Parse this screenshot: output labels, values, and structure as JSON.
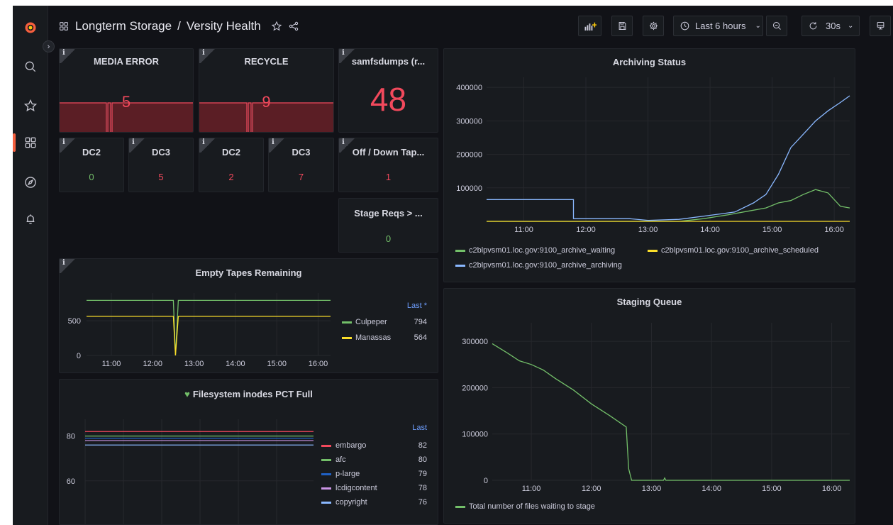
{
  "breadcrumb": {
    "folder": "Longterm Storage",
    "separator": "/",
    "dashboard": "Versity Health"
  },
  "toolbar": {
    "time_range": "Last 6 hours",
    "refresh_interval": "30s"
  },
  "colors": {
    "accent": "#f55f3e",
    "green": "#73bf69",
    "yellow": "#fade2a",
    "red": "#f2495c",
    "blue": "#8ab8ff",
    "dark_blue": "#1f60c4",
    "purple": "#ca95e5",
    "orange": "#ff9830"
  },
  "panels": {
    "media_error": {
      "title": "MEDIA ERROR",
      "value": "5"
    },
    "recycle": {
      "title": "RECYCLE",
      "value": "9"
    },
    "samfsdumps": {
      "title": "samfsdumps (r...",
      "value": "48"
    },
    "dc2_a": {
      "title": "DC2",
      "value": "0"
    },
    "dc3_a": {
      "title": "DC3",
      "value": "5"
    },
    "dc2_b": {
      "title": "DC2",
      "value": "2"
    },
    "dc3_b": {
      "title": "DC3",
      "value": "7"
    },
    "off_down": {
      "title": "Off / Down Tap...",
      "value": "1"
    },
    "stage_reqs": {
      "title": "Stage Reqs > ...",
      "value": "0"
    }
  },
  "chart_data": [
    {
      "type": "line",
      "title": "Archiving Status",
      "x_ticks": [
        "11:00",
        "12:00",
        "13:00",
        "14:00",
        "15:00",
        "16:00"
      ],
      "y_ticks": [
        "100000",
        "200000",
        "300000",
        "400000"
      ],
      "ylim": [
        0,
        430000
      ],
      "series": [
        {
          "name": "c2blpvsm01.loc.gov:9100_archive_waiting",
          "color": "#73bf69",
          "points": [
            [
              10.4,
              0
            ],
            [
              11.0,
              0
            ],
            [
              12.0,
              0
            ],
            [
              12.6,
              0
            ],
            [
              13.0,
              0
            ],
            [
              13.5,
              0
            ],
            [
              13.9,
              8000
            ],
            [
              14.3,
              20000
            ],
            [
              14.6,
              30000
            ],
            [
              14.9,
              40000
            ],
            [
              15.1,
              55000
            ],
            [
              15.3,
              62000
            ],
            [
              15.5,
              80000
            ],
            [
              15.7,
              95000
            ],
            [
              15.9,
              85000
            ],
            [
              16.1,
              45000
            ],
            [
              16.25,
              40000
            ]
          ]
        },
        {
          "name": "c2blpvsm01.loc.gov:9100_archive_scheduled",
          "color": "#fade2a",
          "points": [
            [
              10.4,
              0
            ],
            [
              16.25,
              0
            ]
          ]
        },
        {
          "name": "c2blpvsm01.loc.gov:9100_archive_archiving",
          "color": "#8ab8ff",
          "points": [
            [
              10.4,
              65000
            ],
            [
              11.8,
              65000
            ],
            [
              11.8,
              8000
            ],
            [
              12.7,
              8000
            ],
            [
              13.0,
              3000
            ],
            [
              13.5,
              6000
            ],
            [
              14.0,
              18000
            ],
            [
              14.4,
              28000
            ],
            [
              14.7,
              55000
            ],
            [
              14.9,
              80000
            ],
            [
              15.1,
              140000
            ],
            [
              15.3,
              220000
            ],
            [
              15.5,
              260000
            ],
            [
              15.7,
              300000
            ],
            [
              15.9,
              330000
            ],
            [
              16.1,
              355000
            ],
            [
              16.25,
              375000
            ]
          ]
        }
      ]
    },
    {
      "type": "line",
      "title": "Empty Tapes Remaining",
      "x_ticks": [
        "11:00",
        "12:00",
        "13:00",
        "14:00",
        "15:00",
        "16:00"
      ],
      "y_ticks": [
        "0",
        "500"
      ],
      "ylim": [
        0,
        900
      ],
      "legend_header": "Last *",
      "series": [
        {
          "name": "Culpeper",
          "last": "794",
          "color": "#73bf69",
          "points": [
            [
              10.4,
              794
            ],
            [
              12.5,
              794
            ],
            [
              12.55,
              0
            ],
            [
              12.62,
              794
            ],
            [
              16.3,
              794
            ]
          ]
        },
        {
          "name": "Manassas",
          "last": "564",
          "color": "#fade2a",
          "points": [
            [
              10.4,
              564
            ],
            [
              12.5,
              564
            ],
            [
              12.55,
              0
            ],
            [
              12.62,
              564
            ],
            [
              16.3,
              564
            ]
          ]
        }
      ]
    },
    {
      "type": "line",
      "title": "Filesystem inodes PCT Full",
      "y_ticks": [
        "60",
        "80"
      ],
      "ylim": [
        40,
        90
      ],
      "legend_header": "Last",
      "series": [
        {
          "name": "embargo",
          "last": "82",
          "color": "#f2495c"
        },
        {
          "name": "afc",
          "last": "80",
          "color": "#73bf69"
        },
        {
          "name": "p-large",
          "last": "79",
          "color": "#1f60c4"
        },
        {
          "name": "lcdigcontent",
          "last": "78",
          "color": "#ca95e5"
        },
        {
          "name": "copyright",
          "last": "76",
          "color": "#8ab8ff"
        }
      ]
    },
    {
      "type": "line",
      "title": "Staging Queue",
      "x_ticks": [
        "11:00",
        "12:00",
        "13:00",
        "14:00",
        "15:00",
        "16:00"
      ],
      "y_ticks": [
        "0",
        "100000",
        "200000",
        "300000"
      ],
      "ylim": [
        0,
        340000
      ],
      "series": [
        {
          "name": "Total number of files waiting to stage",
          "color": "#73bf69",
          "points": [
            [
              10.35,
              295000
            ],
            [
              10.6,
              275000
            ],
            [
              10.8,
              258000
            ],
            [
              11.0,
              250000
            ],
            [
              11.2,
              238000
            ],
            [
              11.4,
              220000
            ],
            [
              11.7,
              195000
            ],
            [
              12.0,
              165000
            ],
            [
              12.3,
              140000
            ],
            [
              12.58,
              115000
            ],
            [
              12.62,
              25000
            ],
            [
              12.67,
              0
            ],
            [
              13.2,
              0
            ],
            [
              13.22,
              5000
            ],
            [
              13.24,
              0
            ],
            [
              16.3,
              0
            ]
          ]
        }
      ]
    }
  ]
}
